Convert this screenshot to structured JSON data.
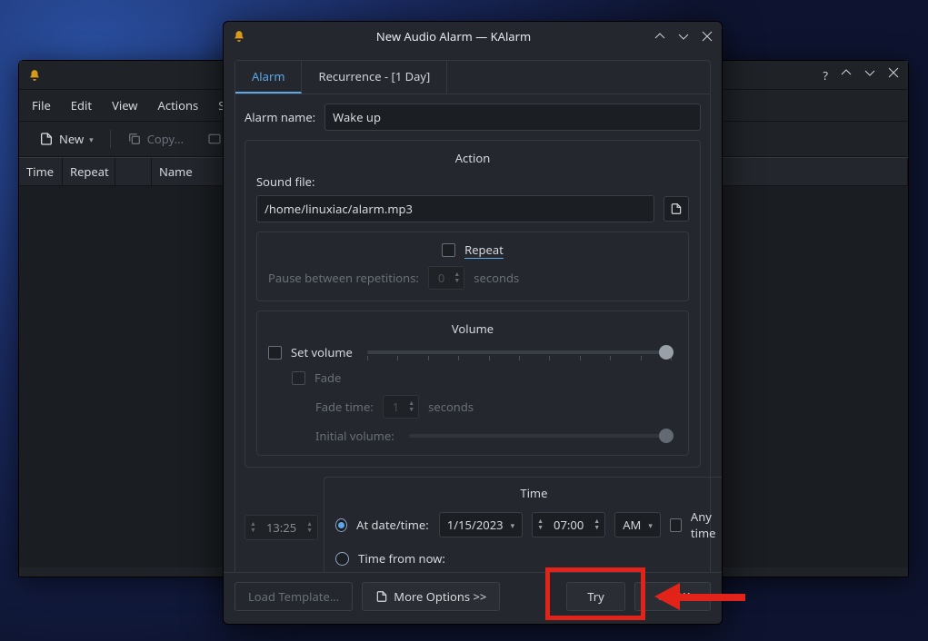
{
  "mainwin": {
    "menu": {
      "file": "File",
      "edit": "Edit",
      "view": "View",
      "actions": "Actions",
      "settings": "Se"
    },
    "toolbar": {
      "new": "New",
      "copy": "Copy..."
    },
    "headers": {
      "time": "Time",
      "repeat": "Repeat",
      "name": "Name"
    },
    "winctrls": {
      "help": "?"
    }
  },
  "dialog": {
    "title": "New Audio Alarm — KAlarm",
    "tabs": {
      "alarm": "Alarm",
      "recurrence": "Recurrence - [1 Day]"
    },
    "alarm_name_label": "Alarm name:",
    "alarm_name_value": "Wake up",
    "action": {
      "title": "Action",
      "sound_file_label": "Sound file:",
      "sound_file_value": "/home/linuxiac/alarm.mp3",
      "repeat_label": "Repeat",
      "pause_label": "Pause between repetitions:",
      "pause_value": "0",
      "pause_unit": "seconds",
      "volume_title": "Volume",
      "set_volume_label": "Set volume",
      "fade_label": "Fade",
      "fade_time_label": "Fade time:",
      "fade_time_value": "1",
      "fade_time_unit": "seconds",
      "initial_volume_label": "Initial volume:"
    },
    "time": {
      "title": "Time",
      "now_value": "13:25",
      "at_label": "At date/time:",
      "date_value": "1/15/2023",
      "time_value": "07:00",
      "ampm_value": "AM",
      "anytime_label": "Any time",
      "from_now_label": "Time from now:"
    },
    "footer": {
      "load_template": "Load Template...",
      "more_options": "More Options >>",
      "try": "Try",
      "ok": "OK"
    }
  }
}
